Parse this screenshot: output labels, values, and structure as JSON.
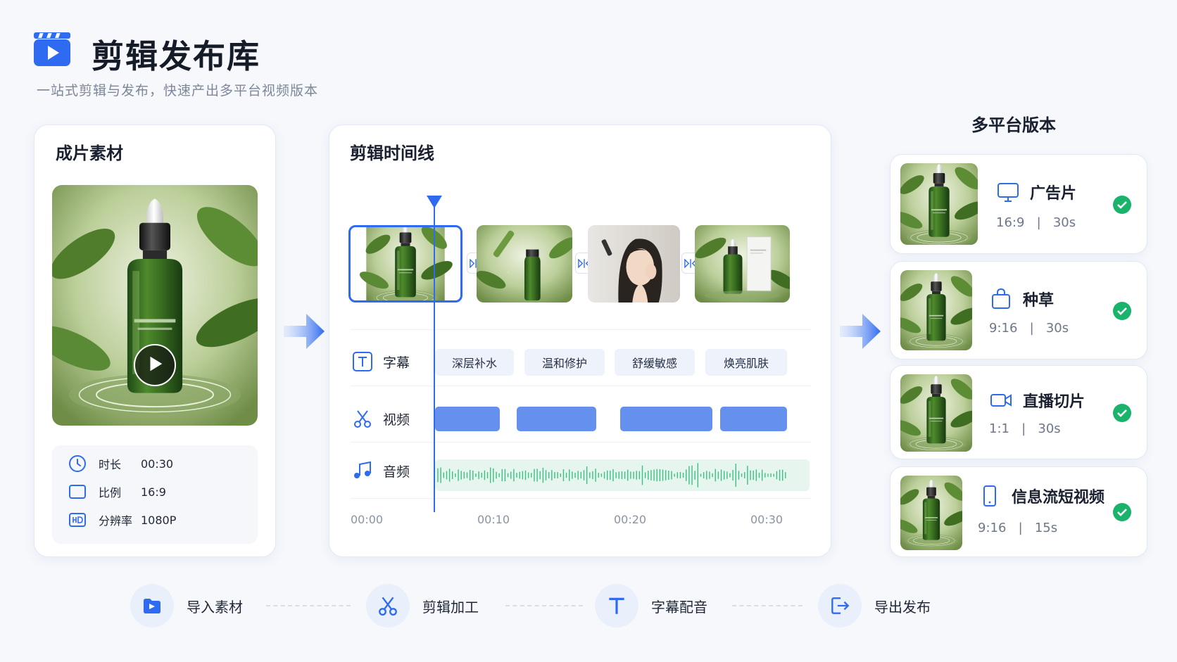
{
  "header": {
    "title": "剪辑发布库",
    "subtitle": "一站式剪辑与发布，快速产出多平台视频版本"
  },
  "source": {
    "title": "成片素材",
    "specs": [
      {
        "icon": "clock-icon",
        "label": "时长",
        "value": "00:30"
      },
      {
        "icon": "aspect-ratio-icon",
        "label": "比例",
        "value": "16:9"
      },
      {
        "icon": "hd-icon",
        "label": "分辨率",
        "value": "1080P"
      }
    ]
  },
  "timeline": {
    "title": "剪辑时间线",
    "tracks": {
      "subtitle": {
        "label": "字幕",
        "icon": "text-icon",
        "chips": [
          "深层补水",
          "温和修护",
          "舒缓敏感",
          "焕亮肌肤"
        ]
      },
      "video": {
        "label": "视频",
        "icon": "scissors-icon"
      },
      "audio": {
        "label": "音频",
        "icon": "music-note-icon"
      }
    },
    "ticks": [
      "00:00",
      "00:10",
      "00:20",
      "00:30"
    ]
  },
  "versions": {
    "title": "多平台版本",
    "items": [
      {
        "name": "广告片",
        "icon": "monitor-icon",
        "ratio": "16:9",
        "sep": "|",
        "duration": "30s"
      },
      {
        "name": "种草",
        "icon": "shopping-bag-icon",
        "ratio": "9:16",
        "sep": "|",
        "duration": "30s"
      },
      {
        "name": "直播切片",
        "icon": "video-camera-icon",
        "ratio": "1:1",
        "sep": "|",
        "duration": "30s"
      },
      {
        "name": "信息流短视频",
        "icon": "mobile-phone-icon",
        "ratio": "9:16",
        "sep": "|",
        "duration": "15s"
      }
    ]
  },
  "steps": [
    {
      "label": "导入素材",
      "icon": "import-folder-icon"
    },
    {
      "label": "剪辑加工",
      "icon": "scissors-icon"
    },
    {
      "label": "字幕配音",
      "icon": "text-icon"
    },
    {
      "label": "导出发布",
      "icon": "export-icon"
    }
  ],
  "colors": {
    "accent": "#2f6bf0",
    "success": "#19b36b",
    "audio": "#3bbf82"
  }
}
